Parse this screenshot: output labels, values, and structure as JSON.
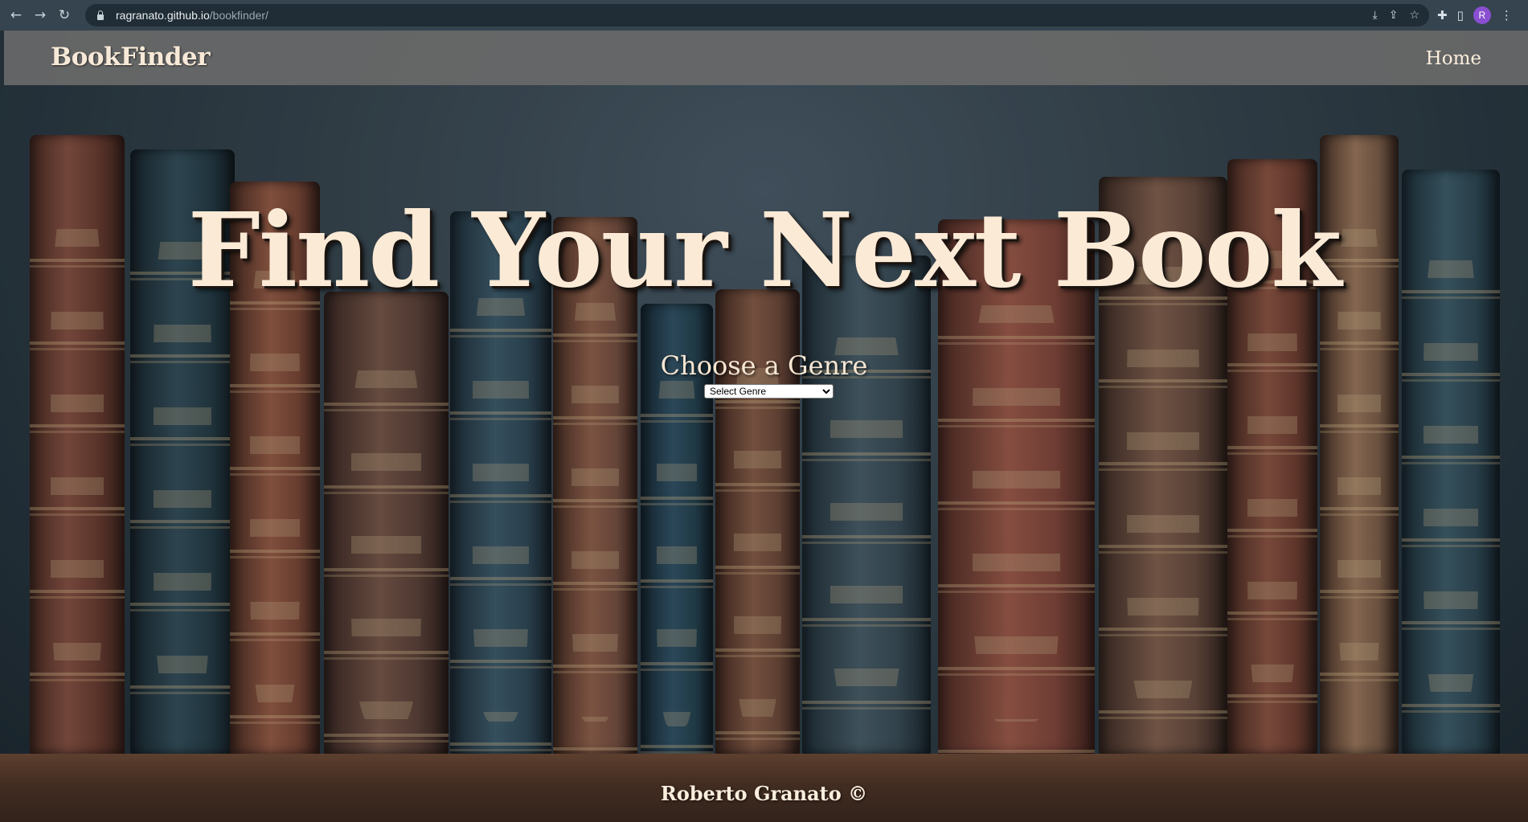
{
  "browser": {
    "url_host": "ragranato.github.io",
    "url_path": "/bookfinder/",
    "profile_initial": "R"
  },
  "header": {
    "brand": "BookFinder",
    "nav_home": "Home"
  },
  "hero": {
    "title": "Find Your Next Book",
    "genre_label": "Choose a Genre",
    "genre_select_value": "Select Genre"
  },
  "footer": {
    "text": "Roberto Granato ©"
  },
  "icons": [
    "back-icon",
    "forward-icon",
    "reload-icon",
    "lock-icon",
    "install-icon",
    "share-icon",
    "star-icon",
    "extensions-icon",
    "side-panel-icon",
    "menu-icon"
  ]
}
